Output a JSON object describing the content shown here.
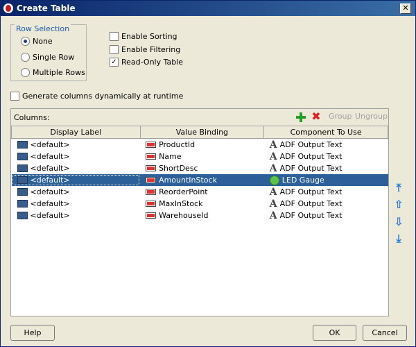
{
  "window": {
    "title": "Create Table"
  },
  "row_selection": {
    "legend": "Row Selection",
    "options": [
      {
        "label": "None",
        "selected": true
      },
      {
        "label": "Single Row",
        "selected": false
      },
      {
        "label": "Multiple Rows",
        "selected": false
      }
    ]
  },
  "options": {
    "enable_sorting": {
      "label": "Enable Sorting",
      "checked": false
    },
    "enable_filtering": {
      "label": "Enable Filtering",
      "checked": false
    },
    "read_only_table": {
      "label": "Read-Only Table",
      "checked": true
    },
    "generate_columns": {
      "label": "Generate columns dynamically at runtime",
      "checked": false
    }
  },
  "columns_panel": {
    "label": "Columns:",
    "group_label": "Group",
    "ungroup_label": "Ungroup",
    "headers": [
      "Display Label",
      "Value Binding",
      "Component To Use"
    ],
    "rows": [
      {
        "display": "<default>",
        "binding": "ProductId",
        "component": "ADF Output Text",
        "component_icon": "text-a-icon",
        "selected": false
      },
      {
        "display": "<default>",
        "binding": "Name",
        "component": "ADF Output Text",
        "component_icon": "text-a-icon",
        "selected": false
      },
      {
        "display": "<default>",
        "binding": "ShortDesc",
        "component": "ADF Output Text",
        "component_icon": "text-a-icon",
        "selected": false
      },
      {
        "display": "<default>",
        "binding": "AmountInStock",
        "component": "LED Gauge",
        "component_icon": "led-icon",
        "selected": true
      },
      {
        "display": "<default>",
        "binding": "ReorderPoint",
        "component": "ADF Output Text",
        "component_icon": "text-a-icon",
        "selected": false
      },
      {
        "display": "<default>",
        "binding": "MaxInStock",
        "component": "ADF Output Text",
        "component_icon": "text-a-icon",
        "selected": false
      },
      {
        "display": "<default>",
        "binding": "WarehouseId",
        "component": "ADF Output Text",
        "component_icon": "text-a-icon",
        "selected": false
      }
    ]
  },
  "buttons": {
    "help": "Help",
    "ok": "OK",
    "cancel": "Cancel"
  },
  "colors": {
    "selection": "#2d6098",
    "title_bar": "#0a246a",
    "accent_blue": "#1f5dad"
  }
}
